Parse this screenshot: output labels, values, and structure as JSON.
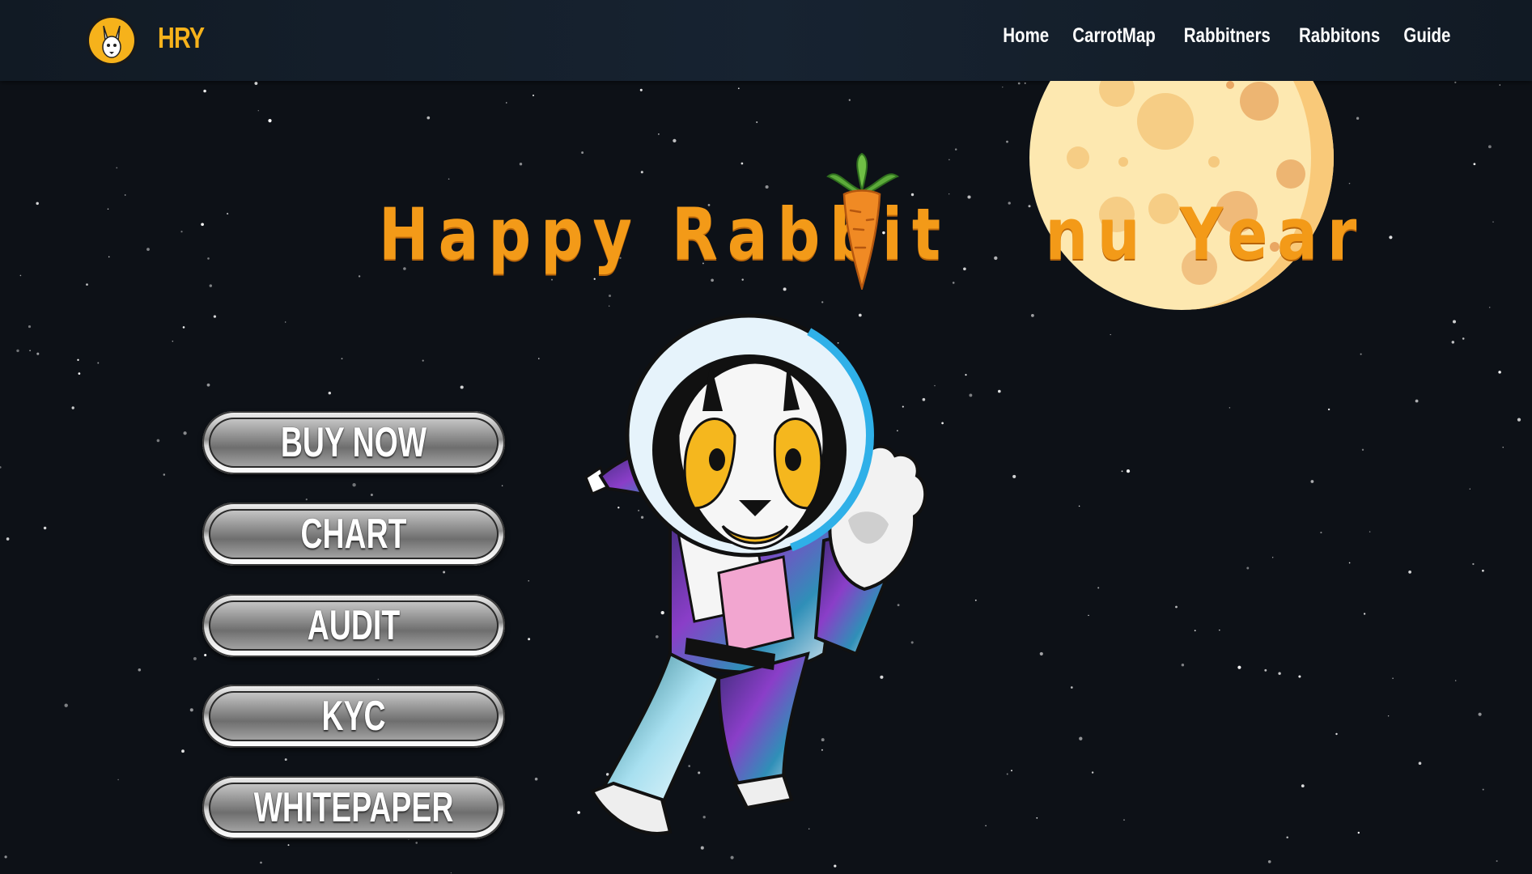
{
  "brand": {
    "name": "HRY",
    "logo_icon": "rabbit-logo-icon",
    "accent": "#f6b21b"
  },
  "nav": {
    "items": [
      "Home",
      "CarrotMap",
      "Rabbitners",
      "Rabbitons",
      "Guide"
    ]
  },
  "hero": {
    "title_part1": "Happy Rabbit",
    "title_part2": "nu Year",
    "title_color": "#f39a18",
    "carrot_icon": "carrot-icon",
    "moon_icon": "moon-illustration",
    "mascot": "astronaut-rabbit-illustration"
  },
  "buttons": [
    "BUY NOW",
    "CHART",
    "AUDIT",
    "KYC",
    "WHITEPAPER"
  ],
  "colors": {
    "background": "#0d1117",
    "navbar": "#172331"
  }
}
